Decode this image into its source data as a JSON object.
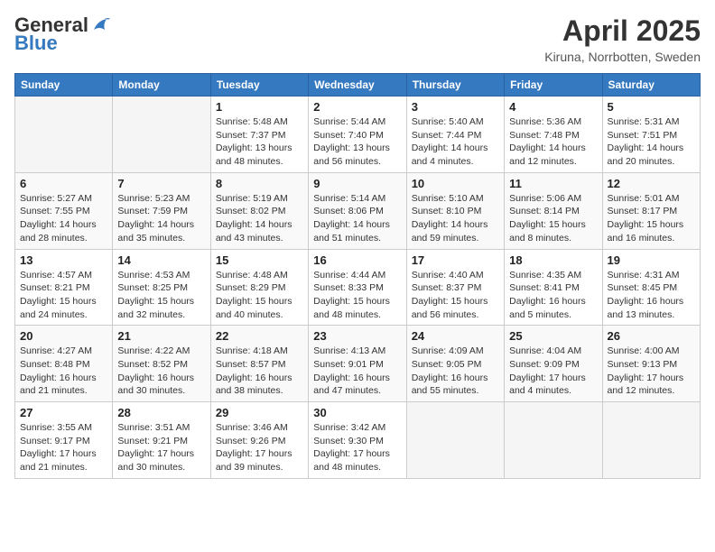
{
  "header": {
    "logo_general": "General",
    "logo_blue": "Blue",
    "month_title": "April 2025",
    "location": "Kiruna, Norrbotten, Sweden"
  },
  "days_of_week": [
    "Sunday",
    "Monday",
    "Tuesday",
    "Wednesday",
    "Thursday",
    "Friday",
    "Saturday"
  ],
  "weeks": [
    [
      {
        "day": "",
        "info": ""
      },
      {
        "day": "",
        "info": ""
      },
      {
        "day": "1",
        "info": "Sunrise: 5:48 AM\nSunset: 7:37 PM\nDaylight: 13 hours\nand 48 minutes."
      },
      {
        "day": "2",
        "info": "Sunrise: 5:44 AM\nSunset: 7:40 PM\nDaylight: 13 hours\nand 56 minutes."
      },
      {
        "day": "3",
        "info": "Sunrise: 5:40 AM\nSunset: 7:44 PM\nDaylight: 14 hours\nand 4 minutes."
      },
      {
        "day": "4",
        "info": "Sunrise: 5:36 AM\nSunset: 7:48 PM\nDaylight: 14 hours\nand 12 minutes."
      },
      {
        "day": "5",
        "info": "Sunrise: 5:31 AM\nSunset: 7:51 PM\nDaylight: 14 hours\nand 20 minutes."
      }
    ],
    [
      {
        "day": "6",
        "info": "Sunrise: 5:27 AM\nSunset: 7:55 PM\nDaylight: 14 hours\nand 28 minutes."
      },
      {
        "day": "7",
        "info": "Sunrise: 5:23 AM\nSunset: 7:59 PM\nDaylight: 14 hours\nand 35 minutes."
      },
      {
        "day": "8",
        "info": "Sunrise: 5:19 AM\nSunset: 8:02 PM\nDaylight: 14 hours\nand 43 minutes."
      },
      {
        "day": "9",
        "info": "Sunrise: 5:14 AM\nSunset: 8:06 PM\nDaylight: 14 hours\nand 51 minutes."
      },
      {
        "day": "10",
        "info": "Sunrise: 5:10 AM\nSunset: 8:10 PM\nDaylight: 14 hours\nand 59 minutes."
      },
      {
        "day": "11",
        "info": "Sunrise: 5:06 AM\nSunset: 8:14 PM\nDaylight: 15 hours\nand 8 minutes."
      },
      {
        "day": "12",
        "info": "Sunrise: 5:01 AM\nSunset: 8:17 PM\nDaylight: 15 hours\nand 16 minutes."
      }
    ],
    [
      {
        "day": "13",
        "info": "Sunrise: 4:57 AM\nSunset: 8:21 PM\nDaylight: 15 hours\nand 24 minutes."
      },
      {
        "day": "14",
        "info": "Sunrise: 4:53 AM\nSunset: 8:25 PM\nDaylight: 15 hours\nand 32 minutes."
      },
      {
        "day": "15",
        "info": "Sunrise: 4:48 AM\nSunset: 8:29 PM\nDaylight: 15 hours\nand 40 minutes."
      },
      {
        "day": "16",
        "info": "Sunrise: 4:44 AM\nSunset: 8:33 PM\nDaylight: 15 hours\nand 48 minutes."
      },
      {
        "day": "17",
        "info": "Sunrise: 4:40 AM\nSunset: 8:37 PM\nDaylight: 15 hours\nand 56 minutes."
      },
      {
        "day": "18",
        "info": "Sunrise: 4:35 AM\nSunset: 8:41 PM\nDaylight: 16 hours\nand 5 minutes."
      },
      {
        "day": "19",
        "info": "Sunrise: 4:31 AM\nSunset: 8:45 PM\nDaylight: 16 hours\nand 13 minutes."
      }
    ],
    [
      {
        "day": "20",
        "info": "Sunrise: 4:27 AM\nSunset: 8:48 PM\nDaylight: 16 hours\nand 21 minutes."
      },
      {
        "day": "21",
        "info": "Sunrise: 4:22 AM\nSunset: 8:52 PM\nDaylight: 16 hours\nand 30 minutes."
      },
      {
        "day": "22",
        "info": "Sunrise: 4:18 AM\nSunset: 8:57 PM\nDaylight: 16 hours\nand 38 minutes."
      },
      {
        "day": "23",
        "info": "Sunrise: 4:13 AM\nSunset: 9:01 PM\nDaylight: 16 hours\nand 47 minutes."
      },
      {
        "day": "24",
        "info": "Sunrise: 4:09 AM\nSunset: 9:05 PM\nDaylight: 16 hours\nand 55 minutes."
      },
      {
        "day": "25",
        "info": "Sunrise: 4:04 AM\nSunset: 9:09 PM\nDaylight: 17 hours\nand 4 minutes."
      },
      {
        "day": "26",
        "info": "Sunrise: 4:00 AM\nSunset: 9:13 PM\nDaylight: 17 hours\nand 12 minutes."
      }
    ],
    [
      {
        "day": "27",
        "info": "Sunrise: 3:55 AM\nSunset: 9:17 PM\nDaylight: 17 hours\nand 21 minutes."
      },
      {
        "day": "28",
        "info": "Sunrise: 3:51 AM\nSunset: 9:21 PM\nDaylight: 17 hours\nand 30 minutes."
      },
      {
        "day": "29",
        "info": "Sunrise: 3:46 AM\nSunset: 9:26 PM\nDaylight: 17 hours\nand 39 minutes."
      },
      {
        "day": "30",
        "info": "Sunrise: 3:42 AM\nSunset: 9:30 PM\nDaylight: 17 hours\nand 48 minutes."
      },
      {
        "day": "",
        "info": ""
      },
      {
        "day": "",
        "info": ""
      },
      {
        "day": "",
        "info": ""
      }
    ]
  ]
}
